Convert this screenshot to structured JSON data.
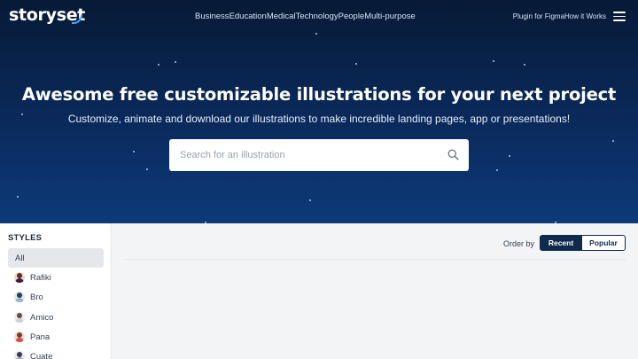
{
  "header": {
    "logo_text": "storyset",
    "nav": [
      "Business",
      "Education",
      "Medical",
      "Technology",
      "People",
      "Multi-purpose"
    ],
    "right_links": [
      "Plugin for Figma",
      "How it Works"
    ]
  },
  "hero": {
    "title": "Awesome free customizable illustrations for your next project",
    "subtitle": "Customize, animate and download our illustrations to make incredible landing pages, app or presentations!",
    "search_placeholder": "Search for an illustration"
  },
  "sidebar": {
    "title": "STYLES",
    "items": [
      {
        "label": "All",
        "active": true
      },
      {
        "label": "Rafiki",
        "avatar": "avatar-rafiki"
      },
      {
        "label": "Bro",
        "avatar": "avatar-bro"
      },
      {
        "label": "Amico",
        "avatar": "avatar-amico"
      },
      {
        "label": "Pana",
        "avatar": "avatar-pana"
      },
      {
        "label": "Cuate",
        "avatar": "avatar-cuate"
      }
    ]
  },
  "content": {
    "order_label": "Order by",
    "order_options": [
      "Recent",
      "Popular"
    ],
    "order_selected": "Recent"
  },
  "colors": {
    "hero_dark": "#071a36",
    "hero_light": "#0d3a7a",
    "accent": "#4aa3ff",
    "button_dark": "#0f2a4a"
  }
}
